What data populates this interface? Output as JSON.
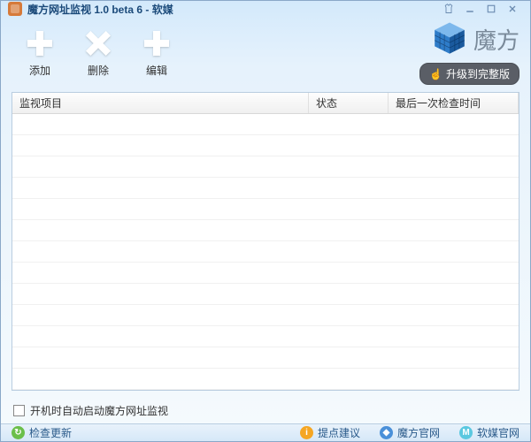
{
  "title": "魔方网址监视 1.0 beta 6 - 软媒",
  "toolbar": {
    "add": "添加",
    "delete": "删除",
    "edit": "编辑"
  },
  "brand": {
    "name": "魔方",
    "upgrade": "升级到完整版"
  },
  "table": {
    "col_item": "监视项目",
    "col_status": "状态",
    "col_lastcheck": "最后一次检查时间"
  },
  "startup": {
    "label": "开机时自动启动魔方网址监视"
  },
  "footer": {
    "check_update": "检查更新",
    "suggest": "提点建议",
    "mofang_site": "魔方官网",
    "ruanmei_site": "软媒官网"
  }
}
